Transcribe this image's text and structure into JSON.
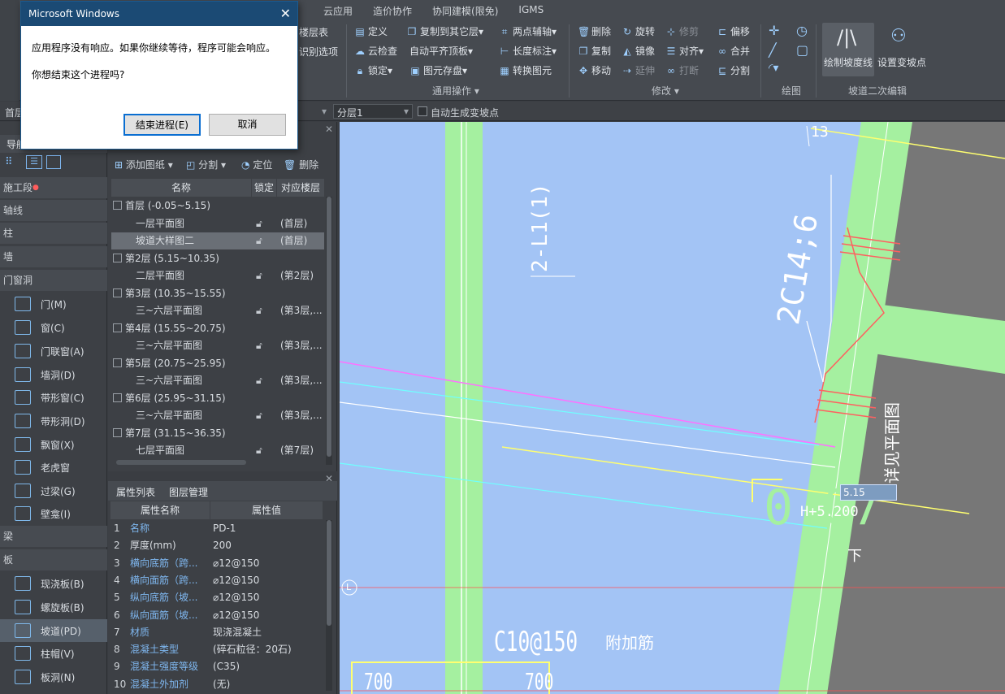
{
  "ribbon": {
    "tabs": [
      "云应用",
      "造价协作",
      "协同建模(限免)",
      "IGMS"
    ],
    "partial_left": [
      "楼层表",
      "识别选项"
    ],
    "common": {
      "define": "定义",
      "copy_to_floor": "复制到其它层",
      "two_point_aux": "两点辅轴",
      "cloud_check": "云检查",
      "auto_flush": "自动平齐顶板",
      "length_label": "长度标注",
      "lock": "锁定",
      "save_element": "图元存盘",
      "convert_element": "转换图元",
      "group": "通用操作"
    },
    "modify": {
      "delete": "删除",
      "rotate": "旋转",
      "trim": "修剪",
      "offset": "偏移",
      "copy": "复制",
      "mirror": "镜像",
      "align": "对齐",
      "merge": "合并",
      "move": "移动",
      "extend": "延伸",
      "break": "打断",
      "split": "分割",
      "group": "修改"
    },
    "draw": {
      "group": "绘图"
    },
    "ramp": {
      "draw_slope_line": "绘制坡度线",
      "set_slope_point": "设置变坡点",
      "group": "坡道二次编辑"
    }
  },
  "subbar": {
    "left_label": "首层",
    "layer_select": "分层1",
    "auto_gen_checkbox": "自动生成变坡点"
  },
  "nav": {
    "header": "导航",
    "sections": [
      "施工段",
      "轴线",
      "柱",
      "墙",
      "门窗洞"
    ],
    "door_items": [
      "门(M)",
      "窗(C)",
      "门联窗(A)",
      "墙洞(D)",
      "带形窗(C)",
      "带形洞(D)",
      "飘窗(X)",
      "老虎窗",
      "过梁(G)",
      "壁龛(I)"
    ],
    "sections2": [
      "梁",
      "板"
    ],
    "slab_items": [
      "现浇板(B)",
      "螺旋板(B)",
      "坡道(PD)",
      "柱帽(V)",
      "板洞(N)"
    ]
  },
  "drawings": {
    "toolbar": {
      "add": "添加图纸",
      "split": "分割",
      "locate": "定位",
      "delete": "删除"
    },
    "headers": {
      "name": "名称",
      "lock": "锁定",
      "floor": "对应楼层"
    },
    "rows": [
      {
        "name": "首层 (-0.05~5.15)",
        "group": true
      },
      {
        "name": "一层平面图",
        "floor": "(首层)"
      },
      {
        "name": "坡道大样图二",
        "floor": "(首层)",
        "selected": true
      },
      {
        "name": "第2层 (5.15~10.35)",
        "group": true
      },
      {
        "name": "二层平面图",
        "floor": "(第2层)"
      },
      {
        "name": "第3层 (10.35~15.55)",
        "group": true
      },
      {
        "name": "三~六层平面图",
        "floor": "(第3层,..."
      },
      {
        "name": "第4层 (15.55~20.75)",
        "group": true
      },
      {
        "name": "三~六层平面图",
        "floor": "(第3层,..."
      },
      {
        "name": "第5层 (20.75~25.95)",
        "group": true
      },
      {
        "name": "三~六层平面图",
        "floor": "(第3层,..."
      },
      {
        "name": "第6层 (25.95~31.15)",
        "group": true
      },
      {
        "name": "三~六层平面图",
        "floor": "(第3层,..."
      },
      {
        "name": "第7层 (31.15~36.35)",
        "group": true
      },
      {
        "name": "七层平面图",
        "floor": "(第7层)"
      }
    ]
  },
  "props": {
    "tabs": [
      "属性列表",
      "图层管理"
    ],
    "headers": {
      "name": "属性名称",
      "value": "属性值"
    },
    "rows": [
      {
        "n": "1",
        "k": "名称",
        "v": "PD-1",
        "blue": true
      },
      {
        "n": "2",
        "k": "厚度(mm)",
        "v": "200",
        "blue": false
      },
      {
        "n": "3",
        "k": "横向底筋（跨...",
        "v": "⌀12@150",
        "blue": true
      },
      {
        "n": "4",
        "k": "横向面筋（跨...",
        "v": "⌀12@150",
        "blue": true
      },
      {
        "n": "5",
        "k": "纵向底筋（坡...",
        "v": "⌀12@150",
        "blue": true
      },
      {
        "n": "6",
        "k": "纵向面筋（坡...",
        "v": "⌀12@150",
        "blue": true
      },
      {
        "n": "7",
        "k": "材质",
        "v": "现浇混凝土",
        "blue": true
      },
      {
        "n": "8",
        "k": "混凝土类型",
        "v": "(碎石粒径：20石)",
        "blue": true
      },
      {
        "n": "9",
        "k": "混凝土强度等级",
        "v": "(C35)",
        "blue": true
      },
      {
        "n": "10",
        "k": "混凝土外加剂",
        "v": "(无)",
        "blue": true
      }
    ]
  },
  "canvas": {
    "t13": "13",
    "l1": "2-L1(1)",
    "rebar": "2C14;6",
    "value_box": "5.15",
    "hplus": "H+5.200",
    "down": "下",
    "c10": "C10@150",
    "fujia": "附加筋",
    "n700a": "700",
    "n700b": "700",
    "L": "L",
    "big07": "0.07",
    "vtext": "详见平面图"
  },
  "dialog": {
    "title": "Microsoft Windows",
    "line1": "应用程序没有响应。如果你继续等待，程序可能会响应。",
    "line2": "你想结束这个进程吗?",
    "end_btn": "结束进程(E)",
    "cancel_btn": "取消"
  }
}
